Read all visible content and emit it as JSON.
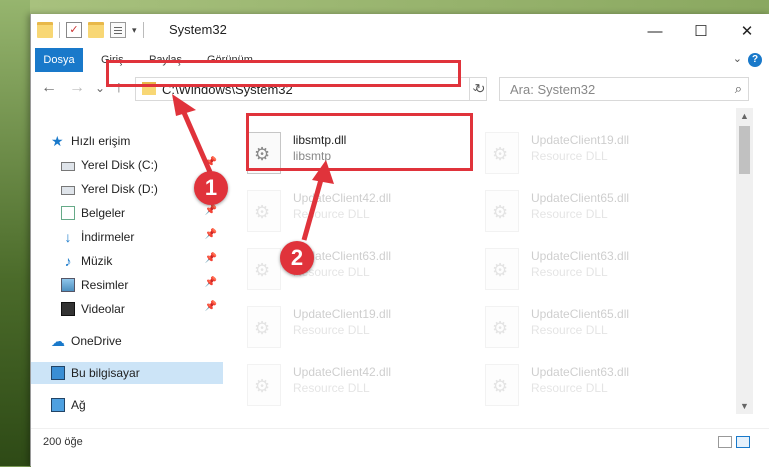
{
  "window": {
    "title": "System32",
    "controls": {
      "minimize": "—",
      "maximize": "☐",
      "close": "✕"
    }
  },
  "ribbon": {
    "tabs": [
      "Dosya",
      "Giriş",
      "Paylaş",
      "Görünüm"
    ],
    "help": "?"
  },
  "navigation": {
    "back": "←",
    "forward": "→",
    "recent": "⌄",
    "up": "↑",
    "address": "C:\\Windows\\System32",
    "refresh": "↻",
    "search_placeholder": "Ara: System32"
  },
  "sidebar": {
    "items": [
      {
        "label": "Hızlı erişim"
      },
      {
        "label": "Yerel Disk (C:)",
        "pinned": true
      },
      {
        "label": "Yerel Disk (D:)",
        "pinned": true
      },
      {
        "label": "Belgeler",
        "pinned": true
      },
      {
        "label": "İndirmeler",
        "pinned": true
      },
      {
        "label": "Müzik",
        "pinned": true
      },
      {
        "label": "Resimler",
        "pinned": true
      },
      {
        "label": "Videolar",
        "pinned": true
      },
      {
        "label": "OneDrive"
      },
      {
        "label": "Bu bilgisayar",
        "selected": true
      },
      {
        "label": "Ağ"
      }
    ]
  },
  "files": [
    {
      "name": "libsmtp.dll",
      "type": "libsmtp"
    },
    {
      "name": "UpdateClient19.dll",
      "type": "Resource DLL"
    },
    {
      "name": "UpdateClient42.dll",
      "type": "Resource DLL"
    },
    {
      "name": "UpdateClient65.dll",
      "type": "Resource DLL"
    },
    {
      "name": "UpdateClient63.dll",
      "type": "Resource DLL"
    },
    {
      "name": "UpdateClient63.dll",
      "type": "Resource DLL"
    },
    {
      "name": "UpdateClient19.dll",
      "type": "Resource DLL"
    },
    {
      "name": "UpdateClient65.dll",
      "type": "Resource DLL"
    },
    {
      "name": "UpdateClient42.dll",
      "type": "Resource DLL"
    },
    {
      "name": "UpdateClient63.dll",
      "type": "Resource DLL"
    }
  ],
  "status": {
    "item_count": "200 öğe"
  },
  "annotations": {
    "marker1": "1",
    "marker2": "2",
    "highlight_color": "#e0333b"
  }
}
